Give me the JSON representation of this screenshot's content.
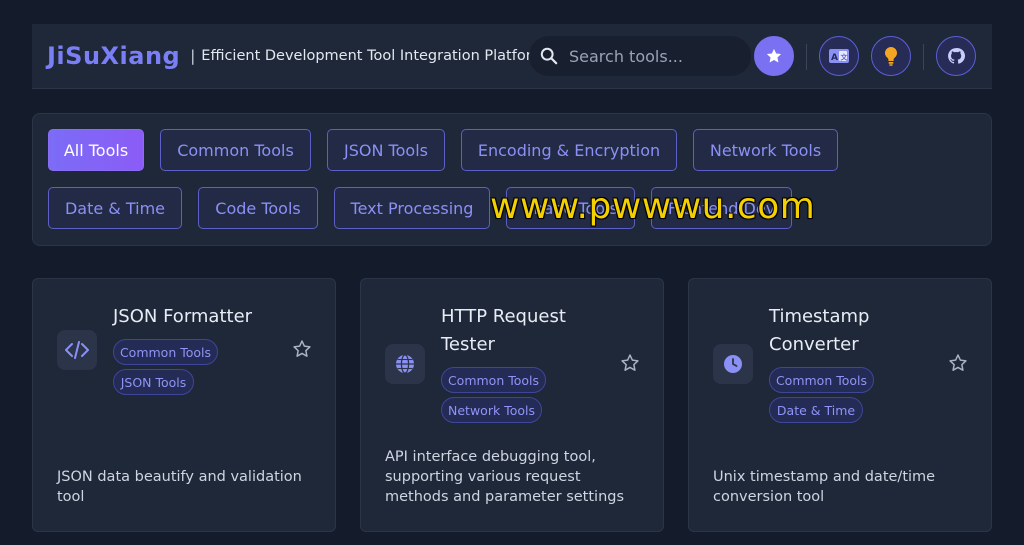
{
  "header": {
    "brand": "JiSuXiang",
    "separator": "|",
    "tagline": "Efficient Development Tool Integration Platform",
    "search_placeholder": "Search tools..."
  },
  "filters": [
    {
      "label": "All Tools",
      "active": true
    },
    {
      "label": "Common Tools"
    },
    {
      "label": "JSON Tools"
    },
    {
      "label": "Encoding & Encryption"
    },
    {
      "label": "Network Tools"
    },
    {
      "label": "Date & Time"
    },
    {
      "label": "Code Tools"
    },
    {
      "label": "Text Processing"
    },
    {
      "label": "Image Tools"
    },
    {
      "label": "Frontend Dev"
    }
  ],
  "watermark": "www.pwwwu.com",
  "tools": [
    {
      "title": "JSON Formatter",
      "icon": "code-icon",
      "tags": [
        "Common Tools",
        "JSON Tools"
      ],
      "description": "JSON data beautify and validation tool"
    },
    {
      "title": "HTTP Request Tester",
      "icon": "globe-icon",
      "tags": [
        "Common Tools",
        "Network Tools"
      ],
      "description": "API interface debugging tool, supporting various request methods and parameter settings"
    },
    {
      "title": "Timestamp Converter",
      "icon": "clock-icon",
      "tags": [
        "Common Tools",
        "Date & Time"
      ],
      "description": "Unix timestamp and date/time conversion tool"
    }
  ],
  "colors": {
    "accent": "#7b7ff6",
    "background": "#141b2b",
    "panel": "#1f2839",
    "watermark": "#f5d000"
  }
}
